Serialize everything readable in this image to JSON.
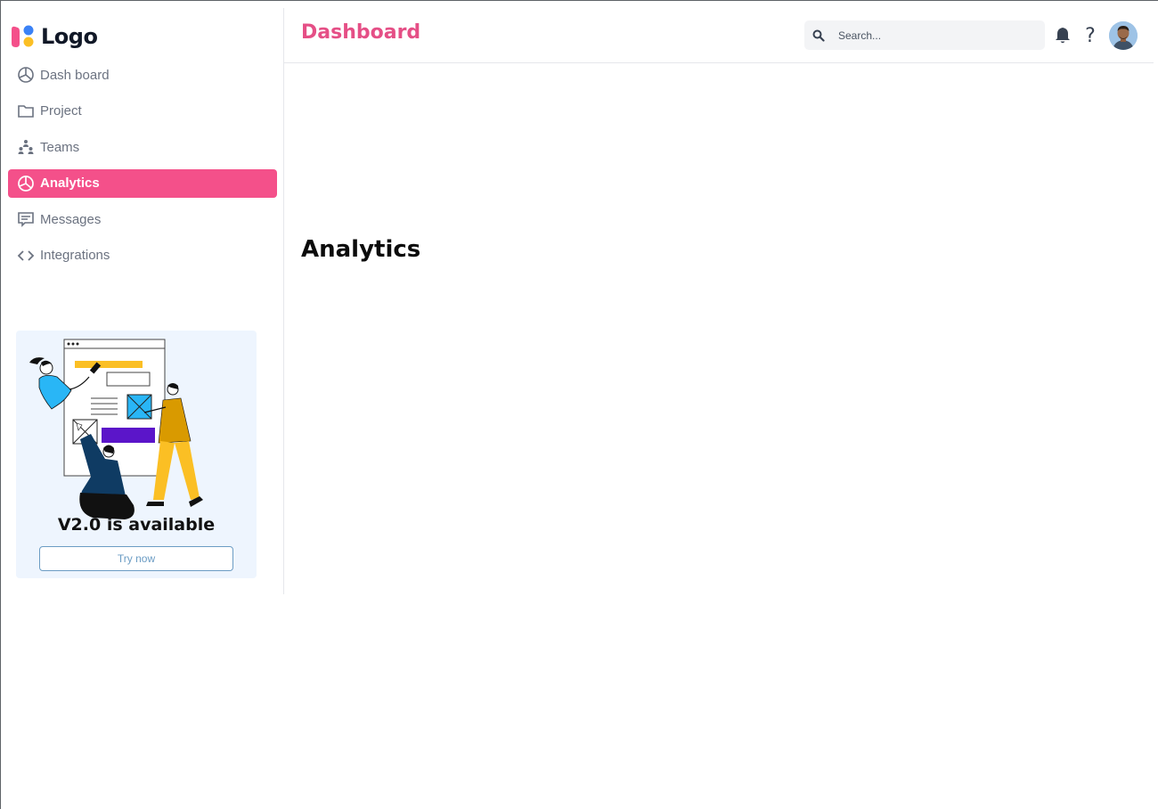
{
  "app": {
    "logo_text": "Logo",
    "brand_colors": [
      "#f4508a",
      "#3b82f6",
      "#fbbf24"
    ]
  },
  "sidebar": {
    "items": [
      {
        "label": "Dash board",
        "icon": "pie-chart-icon",
        "active": false
      },
      {
        "label": "Project",
        "icon": "folder-icon",
        "active": false
      },
      {
        "label": "Teams",
        "icon": "teams-icon",
        "active": false
      },
      {
        "label": "Analytics",
        "icon": "pie-chart-icon",
        "active": true
      },
      {
        "label": "Messages",
        "icon": "message-icon",
        "active": false
      },
      {
        "label": "Integrations",
        "icon": "code-icon",
        "active": false
      }
    ],
    "active_color": "#f4508a",
    "promo": {
      "title": "V2.0 is available",
      "button_label": "Try now"
    }
  },
  "header": {
    "title": "Dashboard",
    "title_color": "#e54f86",
    "search": {
      "placeholder": "Search...",
      "value": ""
    },
    "icons": [
      "bell-icon",
      "help-icon",
      "avatar"
    ]
  },
  "main": {
    "title": "Analytics"
  }
}
